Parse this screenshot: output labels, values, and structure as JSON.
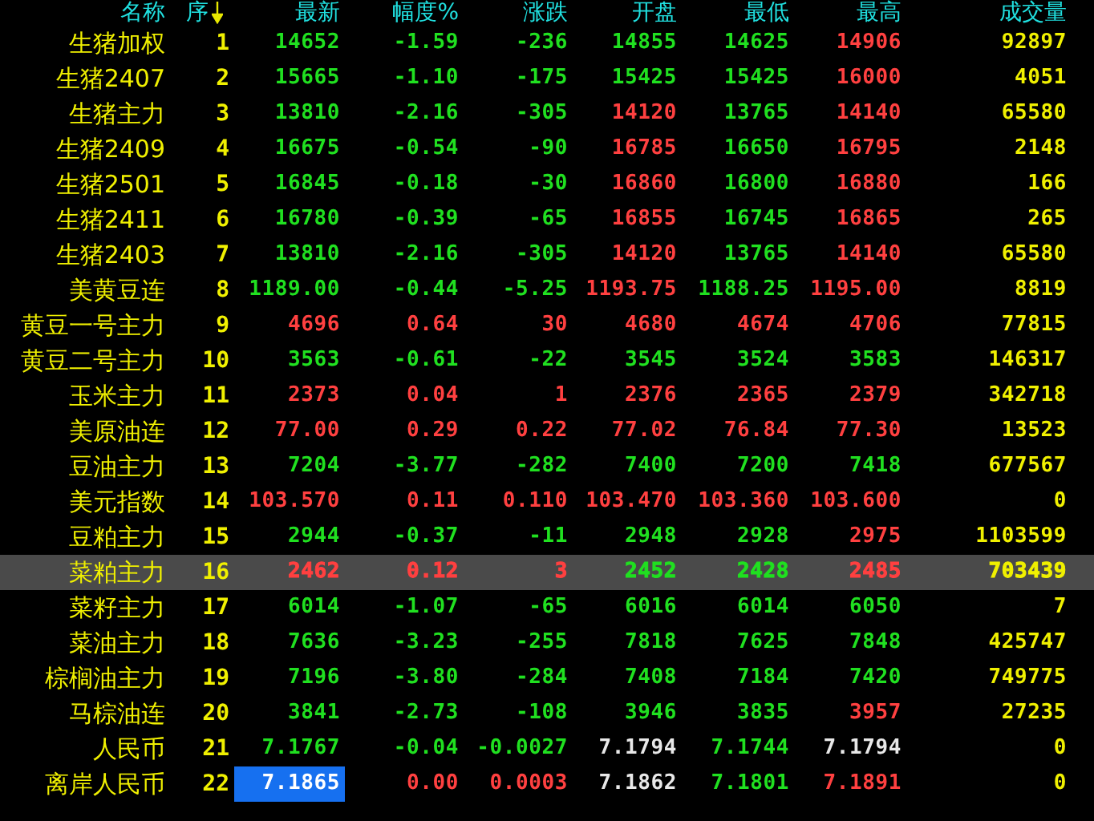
{
  "columns": [
    {
      "label": "名称",
      "sorted": false
    },
    {
      "label": "序",
      "sorted": true
    },
    {
      "label": "最新",
      "sorted": false
    },
    {
      "label": "幅度%",
      "sorted": false
    },
    {
      "label": "涨跌",
      "sorted": false
    },
    {
      "label": "开盘",
      "sorted": false
    },
    {
      "label": "最低",
      "sorted": false
    },
    {
      "label": "最高",
      "sorted": false
    },
    {
      "label": "成交量",
      "sorted": false
    }
  ],
  "rows": [
    {
      "name": "生猪加权",
      "seq": "1",
      "selected": false,
      "focused": false,
      "cells": [
        {
          "text": "14652",
          "color": "#20e020"
        },
        {
          "text": "-1.59",
          "color": "#20e020"
        },
        {
          "text": "-236",
          "color": "#20e020"
        },
        {
          "text": "14855",
          "color": "#20e020"
        },
        {
          "text": "14625",
          "color": "#20e020"
        },
        {
          "text": "14906",
          "color": "#ff4040"
        }
      ],
      "volume": "92897"
    },
    {
      "name": "生猪2407",
      "seq": "2",
      "selected": false,
      "focused": false,
      "cells": [
        {
          "text": "15665",
          "color": "#20e020"
        },
        {
          "text": "-1.10",
          "color": "#20e020"
        },
        {
          "text": "-175",
          "color": "#20e020"
        },
        {
          "text": "15425",
          "color": "#20e020"
        },
        {
          "text": "15425",
          "color": "#20e020"
        },
        {
          "text": "16000",
          "color": "#ff4040"
        }
      ],
      "volume": "4051"
    },
    {
      "name": "生猪主力",
      "seq": "3",
      "selected": false,
      "focused": false,
      "cells": [
        {
          "text": "13810",
          "color": "#20e020"
        },
        {
          "text": "-2.16",
          "color": "#20e020"
        },
        {
          "text": "-305",
          "color": "#20e020"
        },
        {
          "text": "14120",
          "color": "#ff4040"
        },
        {
          "text": "13765",
          "color": "#20e020"
        },
        {
          "text": "14140",
          "color": "#ff4040"
        }
      ],
      "volume": "65580"
    },
    {
      "name": "生猪2409",
      "seq": "4",
      "selected": false,
      "focused": false,
      "cells": [
        {
          "text": "16675",
          "color": "#20e020"
        },
        {
          "text": "-0.54",
          "color": "#20e020"
        },
        {
          "text": "-90",
          "color": "#20e020"
        },
        {
          "text": "16785",
          "color": "#ff4040"
        },
        {
          "text": "16650",
          "color": "#20e020"
        },
        {
          "text": "16795",
          "color": "#ff4040"
        }
      ],
      "volume": "2148"
    },
    {
      "name": "生猪2501",
      "seq": "5",
      "selected": false,
      "focused": false,
      "cells": [
        {
          "text": "16845",
          "color": "#20e020"
        },
        {
          "text": "-0.18",
          "color": "#20e020"
        },
        {
          "text": "-30",
          "color": "#20e020"
        },
        {
          "text": "16860",
          "color": "#ff4040"
        },
        {
          "text": "16800",
          "color": "#20e020"
        },
        {
          "text": "16880",
          "color": "#ff4040"
        }
      ],
      "volume": "166"
    },
    {
      "name": "生猪2411",
      "seq": "6",
      "selected": false,
      "focused": false,
      "cells": [
        {
          "text": "16780",
          "color": "#20e020"
        },
        {
          "text": "-0.39",
          "color": "#20e020"
        },
        {
          "text": "-65",
          "color": "#20e020"
        },
        {
          "text": "16855",
          "color": "#ff4040"
        },
        {
          "text": "16745",
          "color": "#20e020"
        },
        {
          "text": "16865",
          "color": "#ff4040"
        }
      ],
      "volume": "265"
    },
    {
      "name": "生猪2403",
      "seq": "7",
      "selected": false,
      "focused": false,
      "cells": [
        {
          "text": "13810",
          "color": "#20e020"
        },
        {
          "text": "-2.16",
          "color": "#20e020"
        },
        {
          "text": "-305",
          "color": "#20e020"
        },
        {
          "text": "14120",
          "color": "#ff4040"
        },
        {
          "text": "13765",
          "color": "#20e020"
        },
        {
          "text": "14140",
          "color": "#ff4040"
        }
      ],
      "volume": "65580"
    },
    {
      "name": "美黄豆连",
      "seq": "8",
      "selected": false,
      "focused": false,
      "cells": [
        {
          "text": "1189.00",
          "color": "#20e020"
        },
        {
          "text": "-0.44",
          "color": "#20e020"
        },
        {
          "text": "-5.25",
          "color": "#20e020"
        },
        {
          "text": "1193.75",
          "color": "#ff4040"
        },
        {
          "text": "1188.25",
          "color": "#20e020"
        },
        {
          "text": "1195.00",
          "color": "#ff4040"
        }
      ],
      "volume": "8819"
    },
    {
      "name": "黄豆一号主力",
      "seq": "9",
      "selected": false,
      "focused": false,
      "cells": [
        {
          "text": "4696",
          "color": "#ff4040"
        },
        {
          "text": "0.64",
          "color": "#ff4040"
        },
        {
          "text": "30",
          "color": "#ff4040"
        },
        {
          "text": "4680",
          "color": "#ff4040"
        },
        {
          "text": "4674",
          "color": "#ff4040"
        },
        {
          "text": "4706",
          "color": "#ff4040"
        }
      ],
      "volume": "77815"
    },
    {
      "name": "黄豆二号主力",
      "seq": "10",
      "selected": false,
      "focused": false,
      "cells": [
        {
          "text": "3563",
          "color": "#20e020"
        },
        {
          "text": "-0.61",
          "color": "#20e020"
        },
        {
          "text": "-22",
          "color": "#20e020"
        },
        {
          "text": "3545",
          "color": "#20e020"
        },
        {
          "text": "3524",
          "color": "#20e020"
        },
        {
          "text": "3583",
          "color": "#20e020"
        }
      ],
      "volume": "146317"
    },
    {
      "name": "玉米主力",
      "seq": "11",
      "selected": false,
      "focused": false,
      "cells": [
        {
          "text": "2373",
          "color": "#ff4040"
        },
        {
          "text": "0.04",
          "color": "#ff4040"
        },
        {
          "text": "1",
          "color": "#ff4040"
        },
        {
          "text": "2376",
          "color": "#ff4040"
        },
        {
          "text": "2365",
          "color": "#ff4040"
        },
        {
          "text": "2379",
          "color": "#ff4040"
        }
      ],
      "volume": "342718"
    },
    {
      "name": "美原油连",
      "seq": "12",
      "selected": false,
      "focused": false,
      "cells": [
        {
          "text": "77.00",
          "color": "#ff4040"
        },
        {
          "text": "0.29",
          "color": "#ff4040"
        },
        {
          "text": "0.22",
          "color": "#ff4040"
        },
        {
          "text": "77.02",
          "color": "#ff4040"
        },
        {
          "text": "76.84",
          "color": "#ff4040"
        },
        {
          "text": "77.30",
          "color": "#ff4040"
        }
      ],
      "volume": "13523"
    },
    {
      "name": "豆油主力",
      "seq": "13",
      "selected": false,
      "focused": false,
      "cells": [
        {
          "text": "7204",
          "color": "#20e020"
        },
        {
          "text": "-3.77",
          "color": "#20e020"
        },
        {
          "text": "-282",
          "color": "#20e020"
        },
        {
          "text": "7400",
          "color": "#20e020"
        },
        {
          "text": "7200",
          "color": "#20e020"
        },
        {
          "text": "7418",
          "color": "#20e020"
        }
      ],
      "volume": "677567"
    },
    {
      "name": "美元指数",
      "seq": "14",
      "selected": false,
      "focused": false,
      "cells": [
        {
          "text": "103.570",
          "color": "#ff4040"
        },
        {
          "text": "0.11",
          "color": "#ff4040"
        },
        {
          "text": "0.110",
          "color": "#ff4040"
        },
        {
          "text": "103.470",
          "color": "#ff4040"
        },
        {
          "text": "103.360",
          "color": "#ff4040"
        },
        {
          "text": "103.600",
          "color": "#ff4040"
        }
      ],
      "volume": "0"
    },
    {
      "name": "豆粕主力",
      "seq": "15",
      "selected": false,
      "focused": false,
      "cells": [
        {
          "text": "2944",
          "color": "#20e020"
        },
        {
          "text": "-0.37",
          "color": "#20e020"
        },
        {
          "text": "-11",
          "color": "#20e020"
        },
        {
          "text": "2948",
          "color": "#20e020"
        },
        {
          "text": "2928",
          "color": "#20e020"
        },
        {
          "text": "2975",
          "color": "#ff4040"
        }
      ],
      "volume": "1103599"
    },
    {
      "name": "菜粕主力",
      "seq": "16",
      "selected": true,
      "focused": false,
      "cells": [
        {
          "text": "2462",
          "color": "#ff4040"
        },
        {
          "text": "0.12",
          "color": "#ff4040"
        },
        {
          "text": "3",
          "color": "#ff4040"
        },
        {
          "text": "2452",
          "color": "#20e020"
        },
        {
          "text": "2428",
          "color": "#20e020"
        },
        {
          "text": "2485",
          "color": "#ff4040"
        }
      ],
      "volume": "703439"
    },
    {
      "name": "菜籽主力",
      "seq": "17",
      "selected": false,
      "focused": false,
      "cells": [
        {
          "text": "6014",
          "color": "#20e020"
        },
        {
          "text": "-1.07",
          "color": "#20e020"
        },
        {
          "text": "-65",
          "color": "#20e020"
        },
        {
          "text": "6016",
          "color": "#20e020"
        },
        {
          "text": "6014",
          "color": "#20e020"
        },
        {
          "text": "6050",
          "color": "#20e020"
        }
      ],
      "volume": "7"
    },
    {
      "name": "菜油主力",
      "seq": "18",
      "selected": false,
      "focused": false,
      "cells": [
        {
          "text": "7636",
          "color": "#20e020"
        },
        {
          "text": "-3.23",
          "color": "#20e020"
        },
        {
          "text": "-255",
          "color": "#20e020"
        },
        {
          "text": "7818",
          "color": "#20e020"
        },
        {
          "text": "7625",
          "color": "#20e020"
        },
        {
          "text": "7848",
          "color": "#20e020"
        }
      ],
      "volume": "425747"
    },
    {
      "name": "棕榈油主力",
      "seq": "19",
      "selected": false,
      "focused": false,
      "cells": [
        {
          "text": "7196",
          "color": "#20e020"
        },
        {
          "text": "-3.80",
          "color": "#20e020"
        },
        {
          "text": "-284",
          "color": "#20e020"
        },
        {
          "text": "7408",
          "color": "#20e020"
        },
        {
          "text": "7184",
          "color": "#20e020"
        },
        {
          "text": "7420",
          "color": "#20e020"
        }
      ],
      "volume": "749775"
    },
    {
      "name": "马棕油连",
      "seq": "20",
      "selected": false,
      "focused": false,
      "cells": [
        {
          "text": "3841",
          "color": "#20e020"
        },
        {
          "text": "-2.73",
          "color": "#20e020"
        },
        {
          "text": "-108",
          "color": "#20e020"
        },
        {
          "text": "3946",
          "color": "#20e020"
        },
        {
          "text": "3835",
          "color": "#20e020"
        },
        {
          "text": "3957",
          "color": "#ff4040"
        }
      ],
      "volume": "27235"
    },
    {
      "name": "人民币",
      "seq": "21",
      "selected": false,
      "focused": false,
      "cells": [
        {
          "text": "7.1767",
          "color": "#20e020"
        },
        {
          "text": "-0.04",
          "color": "#20e020"
        },
        {
          "text": "-0.0027",
          "color": "#20e020"
        },
        {
          "text": "7.1794",
          "color": "#e8e8e8"
        },
        {
          "text": "7.1744",
          "color": "#20e020"
        },
        {
          "text": "7.1794",
          "color": "#e8e8e8"
        }
      ],
      "volume": "0"
    },
    {
      "name": "离岸人民币",
      "seq": "22",
      "selected": false,
      "focused": true,
      "cells": [
        {
          "text": "7.1865",
          "color": "#ffffff"
        },
        {
          "text": "0.00",
          "color": "#ff4040"
        },
        {
          "text": "0.0003",
          "color": "#ff4040"
        },
        {
          "text": "7.1862",
          "color": "#e8e8e8"
        },
        {
          "text": "7.1801",
          "color": "#20e020"
        },
        {
          "text": "7.1891",
          "color": "#ff4040"
        }
      ],
      "volume": "0"
    }
  ]
}
